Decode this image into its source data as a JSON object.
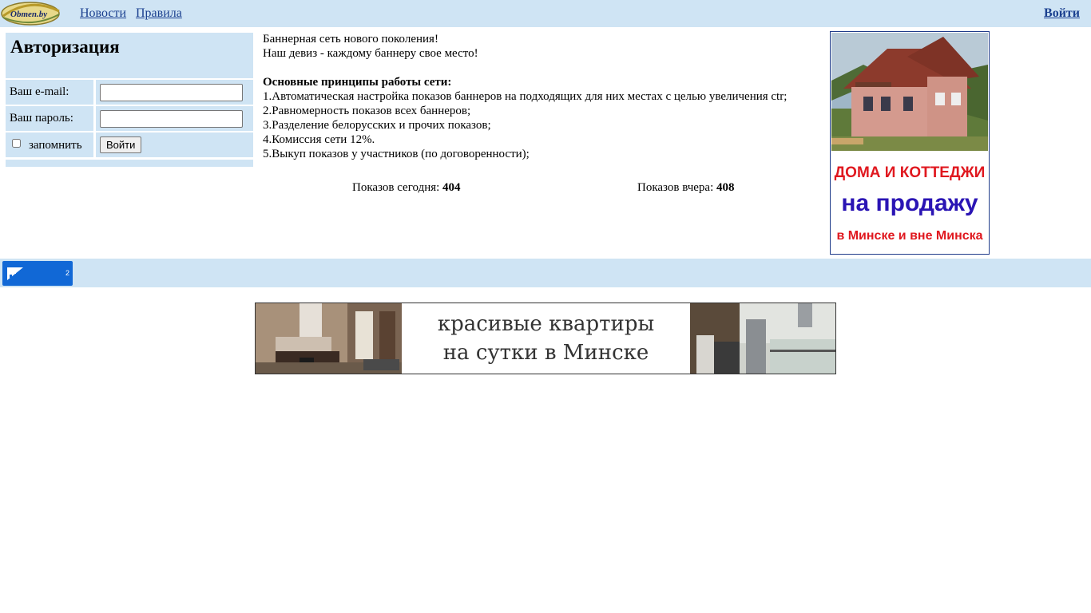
{
  "header": {
    "logo_text": "Obmen.by",
    "nav": [
      "Новости",
      "Правила"
    ],
    "login_link": "Войти"
  },
  "auth": {
    "title": "Авторизация",
    "email_label": "Ваш e-mail:",
    "password_label": "Ваш пароль:",
    "email_value": "",
    "password_value": "",
    "remember_label": "запомнить",
    "remember_checked": false,
    "submit_label": "Войти"
  },
  "intro": {
    "line1": "Баннерная сеть нового поколения!",
    "line2": "Наш девиз - каждому баннеру свое место!",
    "principles_title": "Основные принципы работы сети:",
    "principles": [
      "1.Автоматическая настройка показов баннеров на подходящих для них местах с целью увеличения ctr;",
      "2.Равномерность показов всех баннеров;",
      "3.Разделение белорусских и прочих показов;",
      "4.Комиссия сети 12%.",
      "5.Выкуп показов у участников (по договоренности);"
    ]
  },
  "stats": {
    "today_label": "Показов сегодня:",
    "today_value": "404",
    "yesterday_label": "Показов вчера:",
    "yesterday_value": "408"
  },
  "house_banner": {
    "line1": "ДОМА И КОТТЕДЖИ",
    "line2": "на продажу",
    "line3": "в Минске и вне Минска"
  },
  "counter": {
    "value": "2"
  },
  "apartment_banner": {
    "line1": "красивые квартиры",
    "line2": "на сутки в Минске"
  },
  "colors": {
    "bar": "#cfe4f4",
    "link": "#1a3f8f",
    "banner_red": "#e0181f",
    "banner_blue": "#2a14b4",
    "counter_blue": "#1168d6"
  }
}
